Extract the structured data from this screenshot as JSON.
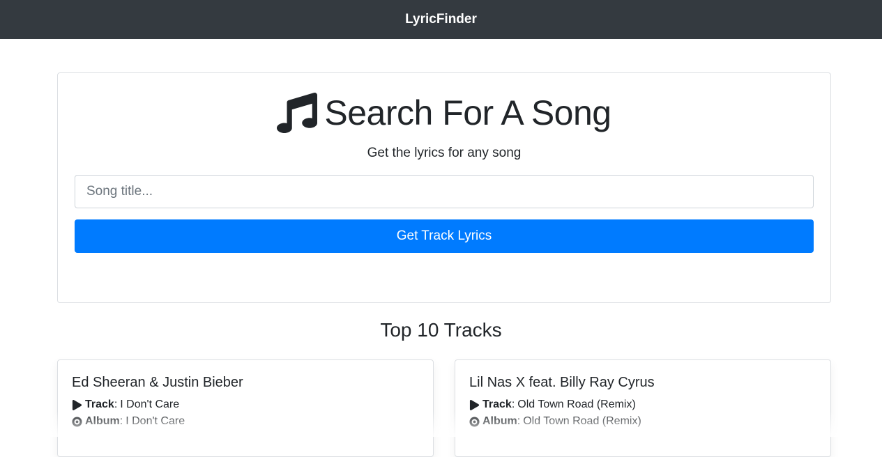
{
  "navbar": {
    "brand": "LyricFinder"
  },
  "search": {
    "title": "Search For A Song",
    "subtitle": "Get the lyrics for any song",
    "input_placeholder": "Song title...",
    "input_value": "",
    "button_label": "Get Track Lyrics",
    "title_icon": "music-note-icon"
  },
  "tracks_section": {
    "heading": "Top 10 Tracks",
    "track_label": "Track",
    "album_label": "Album",
    "items": [
      {
        "artist": "Ed Sheeran & Justin Bieber",
        "track": "I Don't Care",
        "album": "I Don't Care"
      },
      {
        "artist": "Lil Nas X feat. Billy Ray Cyrus",
        "track": "Old Town Road (Remix)",
        "album": "Old Town Road (Remix)"
      }
    ]
  },
  "colors": {
    "navbar_bg": "#343a40",
    "primary_button": "#007bff",
    "text": "#212529"
  }
}
